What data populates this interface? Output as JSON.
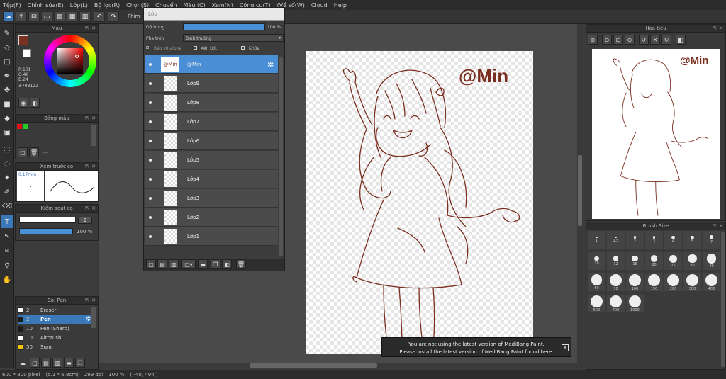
{
  "menu": [
    "Tệp(F)",
    "Chỉnh sửa(E)",
    "Lớp(L)",
    "Bộ lọc(R)",
    "Chọn(S)",
    "Chuyển",
    "Màu (C)",
    "Xem(N)",
    "Cộng cụ(T)",
    "(Về sổ(W)",
    "Cloud",
    "Help"
  ],
  "toolbar": {
    "label": "Phím"
  },
  "layer_panel": {
    "search_placeholder": "Lớp",
    "opacity_label": "Độ trong",
    "opacity_value": "100 %",
    "opacity_fraction": 1.0,
    "blend_label": "Pha trộn",
    "blend_value": "Bình thường",
    "check_alpha": "Bảo vệ alpha",
    "check_clip": "Xén bớt",
    "check_lock": "Khóa",
    "selected_thumb_text": "@Min",
    "layers": [
      "@Min",
      "Lớp9",
      "Lớp8",
      "Lớp7",
      "Lớp6",
      "Lớp5",
      "Lớp4",
      "Lớp3",
      "Lớp2",
      "Lớp1"
    ]
  },
  "color_panel": {
    "title": "Màu",
    "r": "R:101",
    "g": "G:46",
    "b": "B:24",
    "hex": "#793122",
    "main_color": "#793122"
  },
  "palette_panel": {
    "title": "Bảng màu",
    "dash": "---"
  },
  "brush_preview": {
    "title": "Xem trước cọ",
    "size": "0.17mm"
  },
  "brush_control": {
    "title": "Kiểm soát cọ",
    "size_value": "2",
    "opacity_value": "100 %"
  },
  "brush_panel": {
    "title": "Cọ: Pen",
    "items": [
      {
        "num": "2",
        "name": "Eraser",
        "color": "#ffffff"
      },
      {
        "num": "2",
        "name": "Pen",
        "color": "#1a1a1a"
      },
      {
        "num": "10",
        "name": "Pen (Sharp)",
        "color": "#1a1a1a"
      },
      {
        "num": "100",
        "name": "Airbrush",
        "color": "#ffffff"
      },
      {
        "num": "50",
        "name": "Sumi",
        "color": "#f5c400"
      }
    ]
  },
  "navigator": {
    "title": "Hoa tiêu",
    "watermark": "@Min"
  },
  "brush_size": {
    "title": "Brush Size",
    "sizes": [
      "1",
      "1.5",
      "2",
      "3",
      "4",
      "5",
      "7",
      "10",
      "12",
      "15",
      "20",
      "25",
      "30",
      "40",
      "50",
      "70",
      "100",
      "150",
      "200",
      "300",
      "400",
      "500",
      "700",
      "1000"
    ]
  },
  "canvas": {
    "watermark": "@Min",
    "line_color": "#7a2e1f"
  },
  "notification": {
    "line1": "You are not using the latest version of MediBang Paint.",
    "line2": "Please install the latest version of MediBang Paint found here."
  },
  "status": {
    "size": "600 * 800 pixel",
    "cm": "(5.1 * 6.8cm)",
    "dpi": "299 dpi",
    "zoom": "100 %",
    "coords": "( -40, 494 )"
  }
}
